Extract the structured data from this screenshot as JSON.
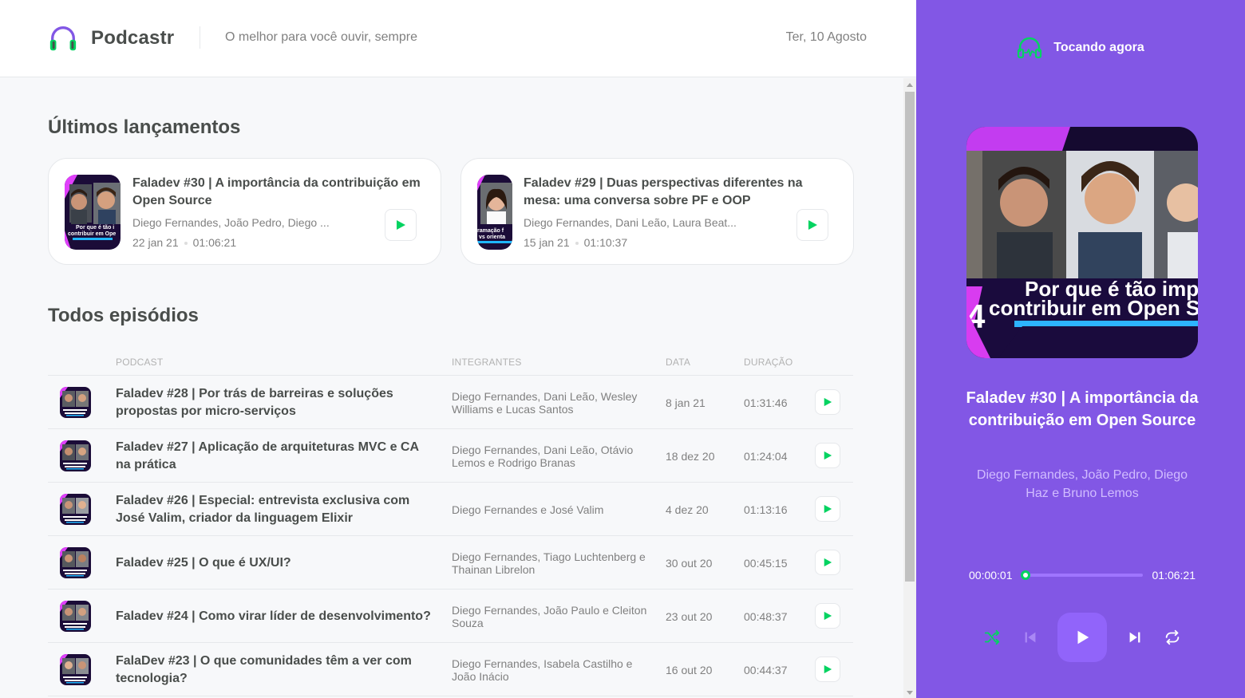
{
  "header": {
    "app_name": "Podcastr",
    "tagline": "O melhor para você ouvir, sempre",
    "date": "Ter, 10 Agosto"
  },
  "latest": {
    "title": "Últimos lançamentos",
    "episodes": [
      {
        "title": "Faladev #30 | A importância da contribuição em Open Source",
        "members": "Diego Fernandes, João Pedro, Diego ...",
        "date": "22 jan 21",
        "duration": "01:06:21",
        "thumb_caption": "Por que é tão i contribuir em Ope"
      },
      {
        "title": "Faladev #29 | Duas perspectivas diferentes na mesa: uma conversa sobre PF e OOP",
        "members": "Diego Fernandes, Dani Leão, Laura Beat...",
        "date": "15 jan 21",
        "duration": "01:10:37",
        "thumb_caption": "ramação f vs orienta"
      }
    ]
  },
  "all": {
    "title": "Todos episódios",
    "columns": [
      "Podcast",
      "Integrantes",
      "Data",
      "Duração"
    ],
    "episodes": [
      {
        "title": "Faladev #28 | Por trás de barreiras e soluções propostas por micro-serviços",
        "members": "Diego Fernandes, Dani Leão, Wesley Williams e Lucas Santos",
        "date": "8 jan 21",
        "duration": "01:31:46"
      },
      {
        "title": "Faladev #27 | Aplicação de arquiteturas MVC e CA na prática",
        "members": "Diego Fernandes, Dani Leão, Otávio Lemos e Rodrigo Branas",
        "date": "18 dez 20",
        "duration": "01:24:04"
      },
      {
        "title": "Faladev #26 | Especial: entrevista exclusiva com José Valim, criador da linguagem Elixir",
        "members": "Diego Fernandes e José Valim",
        "date": "4 dez 20",
        "duration": "01:13:16"
      },
      {
        "title": "Faladev #25 | O que é UX/UI?",
        "members": "Diego Fernandes, Tiago Luchtenberg e Thainan Librelon",
        "date": "30 out 20",
        "duration": "00:45:15"
      },
      {
        "title": "Faladev #24 | Como virar líder de desenvolvimento?",
        "members": "Diego Fernandes, João Paulo e Cleiton Souza",
        "date": "23 out 20",
        "duration": "00:48:37"
      },
      {
        "title": "FalaDev #23 | O que comunidades têm a ver com tecnologia?",
        "members": "Diego Fernandes, Isabela Castilho e João Inácio",
        "date": "16 out 20",
        "duration": "00:44:37"
      }
    ]
  },
  "player": {
    "heading": "Tocando agora",
    "title": "Faladev #30 | A importância da contribuição em Open Source",
    "members": "Diego Fernandes, João Pedro, Diego Haz e Bruno Lemos",
    "cover_caption_1": "Por que é tão imp",
    "cover_caption_2": "contribuir em Open S",
    "cover_number": "4",
    "current_time": "00:00:01",
    "total_time": "01:06:21",
    "progress": 0.0003
  },
  "colors": {
    "purple": "#8257e5",
    "green": "#04d361",
    "text": "#494d4b",
    "muted": "#808080"
  }
}
